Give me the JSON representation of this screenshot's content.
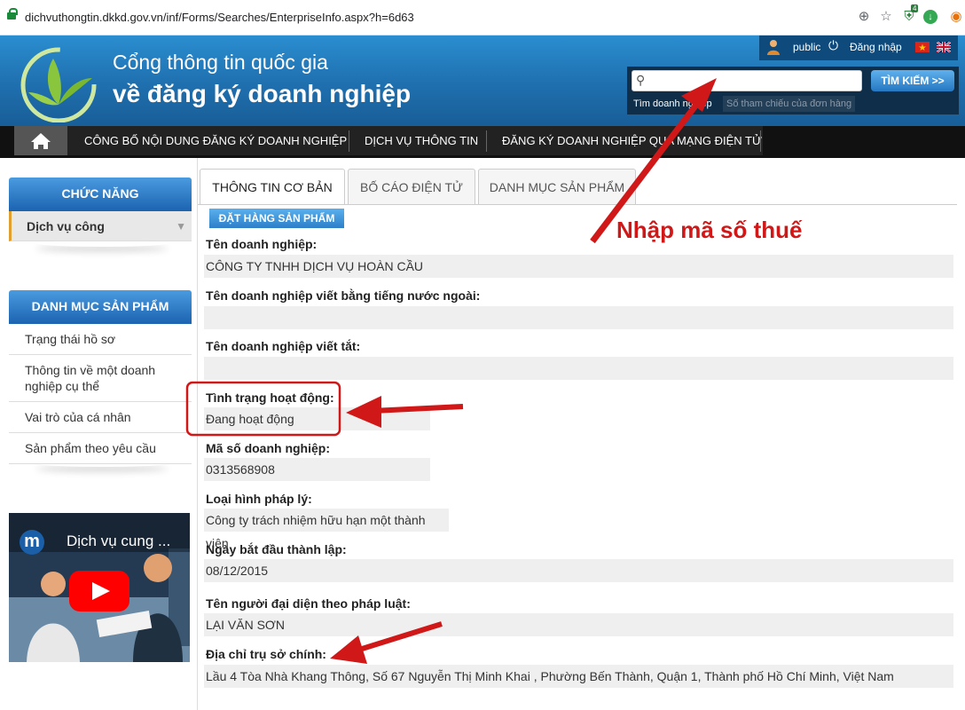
{
  "browser": {
    "url": "dichvuthongtin.dkkd.gov.vn/inf/Forms/Searches/EnterpriseInfo.aspx?h=6d63",
    "badge_count": "4"
  },
  "header": {
    "title_line1": "Cổng thông tin quốc gia",
    "title_line2": "về đăng ký doanh nghiệp",
    "user": "public",
    "login": "Đăng nhập",
    "search_button": "TÌM KIẾM >>",
    "search_tab_active": "Tìm doanh nghiệp",
    "search_tab_inactive": "Số tham chiếu của đơn hàng"
  },
  "nav": {
    "items": [
      "CÔNG BỐ NỘI DUNG ĐĂNG KÝ DOANH NGHIỆP",
      "DỊCH VỤ THÔNG TIN",
      "ĐĂNG KÝ DOANH NGHIỆP QUA MẠNG ĐIỆN TỬ"
    ]
  },
  "sidebar": {
    "functions_title": "CHỨC NĂNG",
    "functions_item": "Dịch vụ công",
    "products_title": "DANH MỤC SẢN PHẨM",
    "products": [
      "Trạng thái hồ sơ",
      "Thông tin về một doanh nghiệp cụ thể",
      "Vai trò của cá nhân",
      "Sản phẩm theo yêu cầu"
    ],
    "video_title": "Dịch vụ cung ..."
  },
  "main": {
    "tabs": [
      "THÔNG TIN CƠ BẢN",
      "BỐ CÁO ĐIỆN TỬ",
      "DANH MỤC SẢN PHẨM"
    ],
    "order_button": "ĐẶT HÀNG SẢN PHẨM",
    "fields": [
      {
        "label": "Tên doanh nghiệp:",
        "value": "CÔNG TY TNHH DỊCH VỤ HOÀN CẦU"
      },
      {
        "label": "Tên doanh nghiệp viết bằng tiếng nước ngoài:",
        "value": ""
      },
      {
        "label": "Tên doanh nghiệp viết tắt:",
        "value": ""
      },
      {
        "label": "Tình trạng hoạt động:",
        "value": "Đang hoạt động"
      },
      {
        "label": "Mã số doanh nghiệp:",
        "value": "0313568908"
      },
      {
        "label": "Loại hình pháp lý:",
        "value": "Công ty trách nhiệm hữu hạn một thành viên"
      },
      {
        "label": "Ngày bắt đầu thành lập:",
        "value": "08/12/2015"
      },
      {
        "label": "Tên người đại diện theo pháp luật:",
        "value": "LẠI VĂN SƠN"
      },
      {
        "label": "Địa chỉ trụ sở chính:",
        "value": "Lầu 4 Tòa Nhà Khang Thông, Số 67 Nguyễn Thị Minh Khai , Phường Bến Thành, Quận 1, Thành phố Hồ Chí Minh, Việt Nam"
      }
    ]
  },
  "annotation": {
    "text": "Nhập mã số thuế"
  },
  "colors": {
    "header": "#1f6fae",
    "accent": "#2d7fc8",
    "annotation": "#d01818"
  }
}
